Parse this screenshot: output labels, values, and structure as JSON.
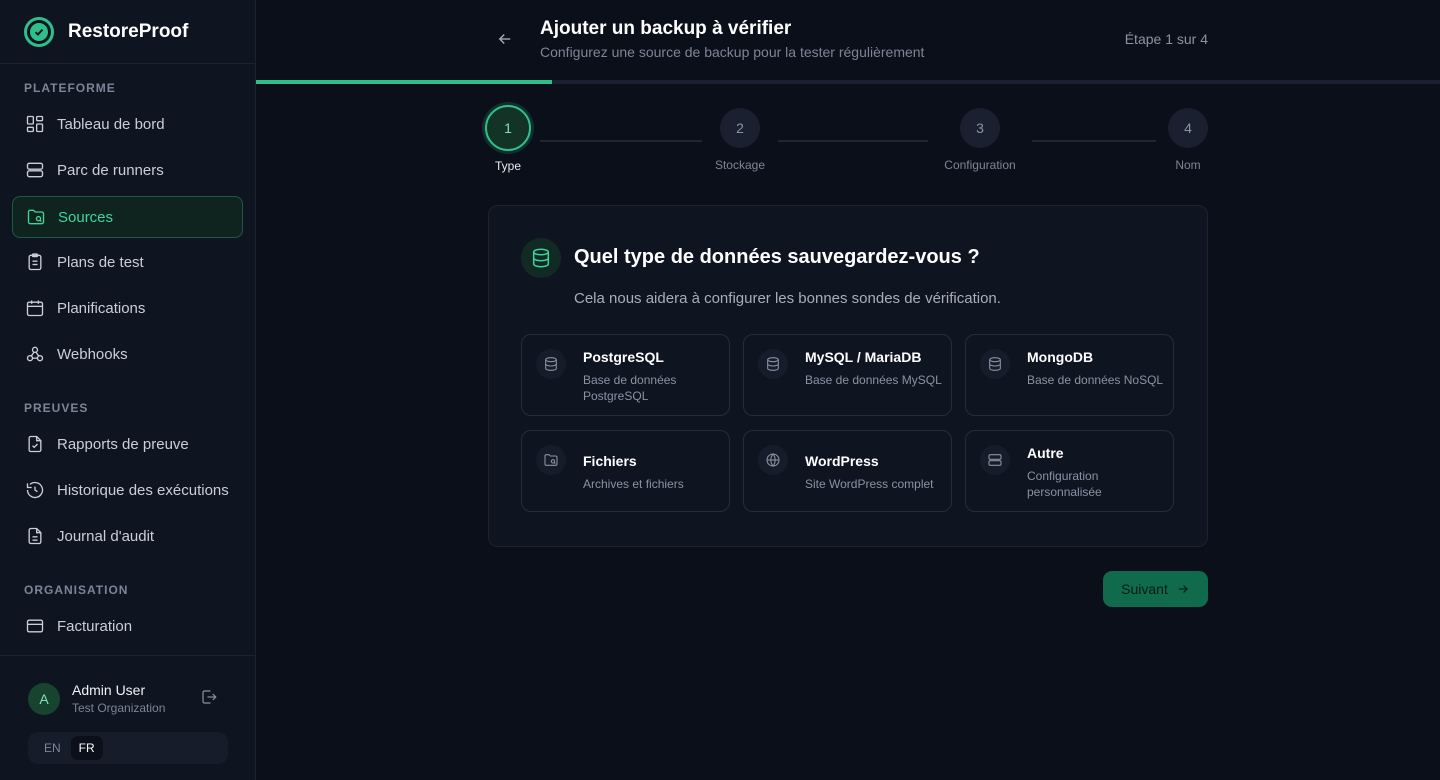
{
  "brand": {
    "name": "RestoreProof"
  },
  "sidebar": {
    "sections": [
      {
        "title": "PLATEFORME",
        "items": [
          {
            "label": "Tableau de bord",
            "icon": "dashboard-icon"
          },
          {
            "label": "Parc de runners",
            "icon": "server-icon"
          },
          {
            "label": "Sources",
            "icon": "folder-icon",
            "active": true
          },
          {
            "label": "Plans de test",
            "icon": "clipboard-icon"
          },
          {
            "label": "Planifications",
            "icon": "calendar-icon"
          },
          {
            "label": "Webhooks",
            "icon": "webhook-icon"
          }
        ]
      },
      {
        "title": "PREUVES",
        "items": [
          {
            "label": "Rapports de preuve",
            "icon": "file-check-icon"
          },
          {
            "label": "Historique des exécutions",
            "icon": "history-icon"
          },
          {
            "label": "Journal d'audit",
            "icon": "file-text-icon"
          }
        ]
      },
      {
        "title": "ORGANISATION",
        "items": [
          {
            "label": "Facturation",
            "icon": "credit-card-icon"
          }
        ]
      }
    ]
  },
  "user": {
    "initial": "A",
    "name": "Admin User",
    "org": "Test Organization"
  },
  "lang": {
    "en": "EN",
    "fr": "FR",
    "selected": "FR"
  },
  "header": {
    "title": "Ajouter un backup à vérifier",
    "subtitle": "Configurez une source de backup pour la tester régulièrement",
    "step_text": "Étape 1 sur 4",
    "progress": 0.25
  },
  "stepper": {
    "steps": [
      {
        "num": "1",
        "label": "Type"
      },
      {
        "num": "2",
        "label": "Stockage"
      },
      {
        "num": "3",
        "label": "Configuration"
      },
      {
        "num": "4",
        "label": "Nom"
      }
    ],
    "current": 1
  },
  "card": {
    "title": "Quel type de données sauvegardez-vous ?",
    "subtitle": "Cela nous aidera à configurer les bonnes sondes de vérification.",
    "options": [
      {
        "title": "PostgreSQL",
        "desc": "Base de données PostgreSQL",
        "icon": "database-icon"
      },
      {
        "title": "MySQL / MariaDB",
        "desc": "Base de données MySQL",
        "icon": "database-icon"
      },
      {
        "title": "MongoDB",
        "desc": "Base de données NoSQL",
        "icon": "database-icon"
      },
      {
        "title": "Fichiers",
        "desc": "Archives et fichiers",
        "icon": "folder-icon"
      },
      {
        "title": "WordPress",
        "desc": "Site WordPress complet",
        "icon": "globe-icon"
      },
      {
        "title": "Autre",
        "desc": "Configuration personnalisée",
        "icon": "server-icon"
      }
    ]
  },
  "actions": {
    "next_label": "Suivant"
  },
  "colors": {
    "accent": "#2fbf88",
    "background": "#0b0f1a",
    "sidebar": "#0f1421"
  }
}
